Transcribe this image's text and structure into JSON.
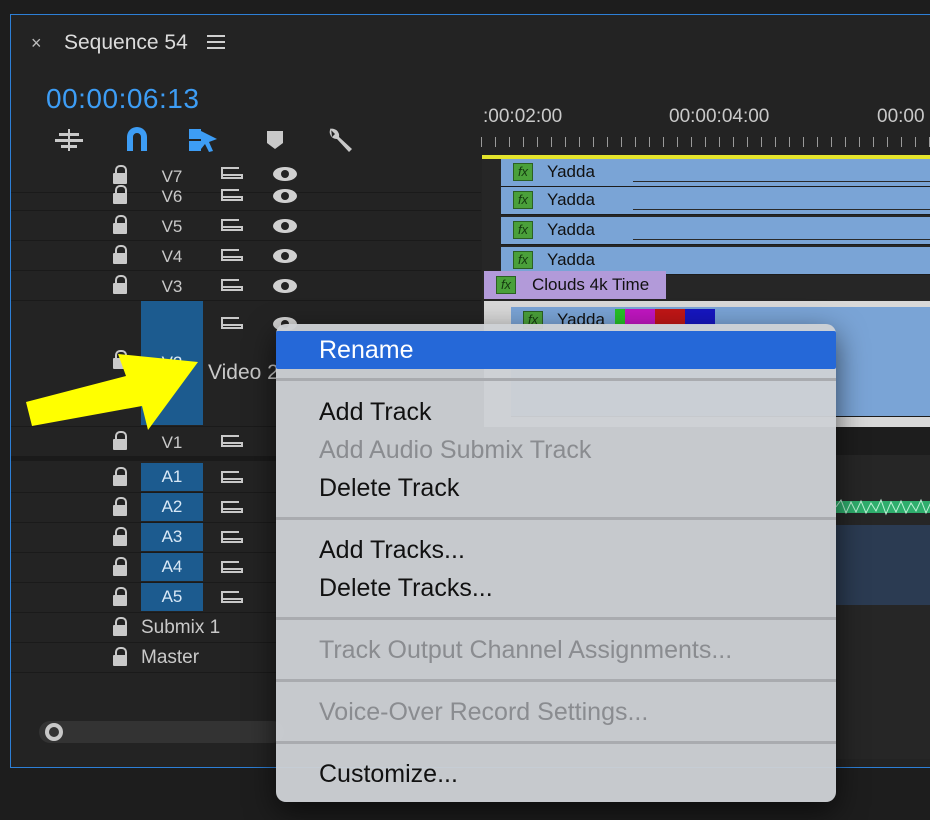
{
  "panel": {
    "title": "Sequence 54",
    "close_glyph": "×",
    "timecode": "00:00:06:13"
  },
  "toolbar": {
    "icons": [
      "nest-sequence-icon",
      "snap-magnet-icon",
      "linked-selection-icon",
      "add-marker-icon",
      "wrench-settings-icon"
    ]
  },
  "ruler": {
    "labels": [
      ":00:02:00",
      "00:00:04:00",
      "00:00"
    ]
  },
  "tracks": {
    "video": [
      "V7",
      "V6",
      "V5",
      "V4",
      "V3",
      "V2",
      "V1"
    ],
    "video2_label": "Video 2",
    "audio": [
      "A1",
      "A2",
      "A3",
      "A4",
      "A5"
    ],
    "submix": "Submix 1",
    "master": "Master"
  },
  "clips": {
    "fx": "fx",
    "yadda": "Yadda",
    "clouds": "Clouds 4k Time"
  },
  "context_menu": {
    "rename": "Rename",
    "add_track": "Add Track",
    "add_audio_submix": "Add Audio Submix Track",
    "delete_track": "Delete Track",
    "add_tracks": "Add Tracks...",
    "delete_tracks": "Delete Tracks...",
    "track_output": "Track Output Channel Assignments...",
    "voice_over": "Voice-Over Record Settings...",
    "customize": "Customize..."
  },
  "colors": {
    "accent": "#3d9df5",
    "selection": "#2568d8",
    "clip_blue": "#7aa4d6",
    "clip_purple": "#b29ad9",
    "playhead_bar": "#e4e42c",
    "arrow": "#ffff00"
  }
}
